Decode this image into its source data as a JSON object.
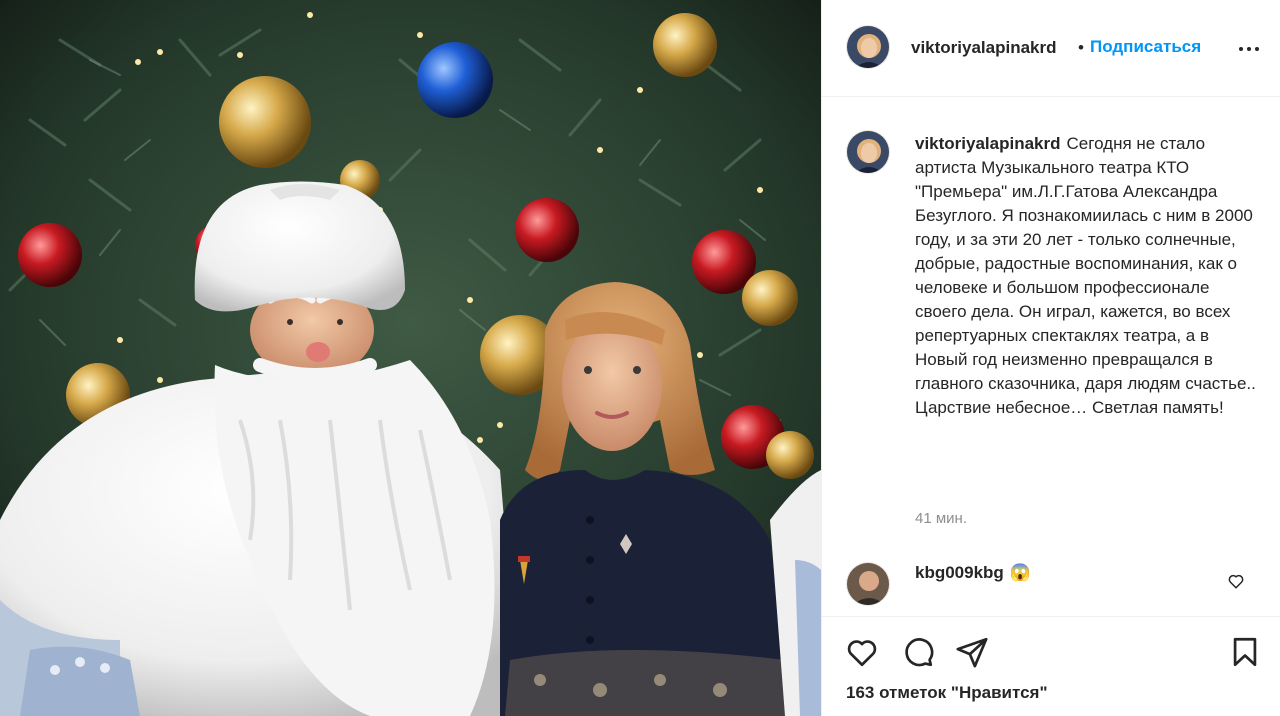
{
  "post": {
    "author": "viktoriyalapinakrd",
    "follow_label": "Подписаться",
    "dot": "•",
    "caption_text": "Сегодня не стало артиста Музыкального театра КТО \"Премьера\" им.Л.Г.Гатова Александра Безуглого. Я познакомиилась с ним в 2000 году, и за эти 20 лет - только солнечные, добрые, радостные воспоминания, как о человеке и большом профессионале своего дела. Он играл, кажется, во всех репертуарных спектаклях театра, а в Новый год неизменно превращался в главного сказочника, даря людям счастье.. Царствие небесное… Светлая память!",
    "time": "41 мин.",
    "likes": "163 отметок \"Нравится\""
  },
  "comment": {
    "user": "kbg009kbg",
    "emoji": "😱"
  },
  "colors": {
    "accent": "#0095f6",
    "text": "#262626",
    "muted": "#8e8e8e"
  },
  "icons": [
    "more-icon",
    "heart-icon",
    "comment-icon",
    "share-icon",
    "bookmark-icon"
  ]
}
